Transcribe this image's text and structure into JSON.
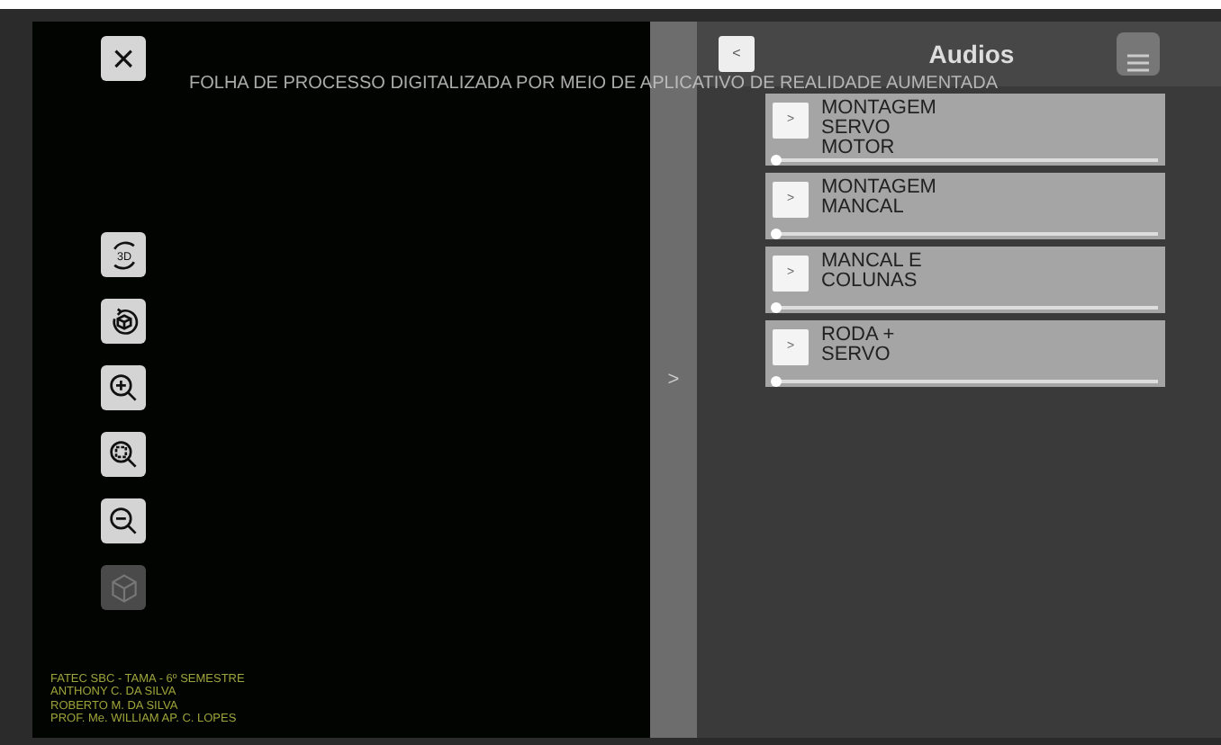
{
  "title": "FOLHA DE PROCESSO DIGITALIZADA POR MEIO DE APLICATIVO DE REALIDADE AUMENTADA",
  "close_button": "×",
  "tools": [
    {
      "kind": "view3d",
      "text": "3D",
      "disabled": false
    },
    {
      "kind": "rotate",
      "disabled": false
    },
    {
      "kind": "zoom_in",
      "disabled": false
    },
    {
      "kind": "zoom_fit",
      "disabled": false
    },
    {
      "kind": "zoom_out",
      "disabled": false
    },
    {
      "kind": "cube",
      "disabled": true
    }
  ],
  "credits": [
    "FATEC SBC - TAMA - 6º SEMESTRE",
    "ANTHONY C. DA SILVA",
    "ROBERTO M. DA SILVA",
    "PROF. Me. WILLIAM AP. C. LOPES"
  ],
  "panel_toggle": ">",
  "audio_panel": {
    "back_button": "<",
    "title": "Audios",
    "items": [
      {
        "label": "MONTAGEM SERVO MOTOR",
        "play": ">",
        "level": 0
      },
      {
        "label": "MONTAGEM MANCAL",
        "play": ">",
        "level": 0
      },
      {
        "label": "MANCAL E COLUNAS",
        "play": ">",
        "level": 0
      },
      {
        "label": "RODA + SERVO",
        "play": ">",
        "level": 0
      }
    ]
  }
}
